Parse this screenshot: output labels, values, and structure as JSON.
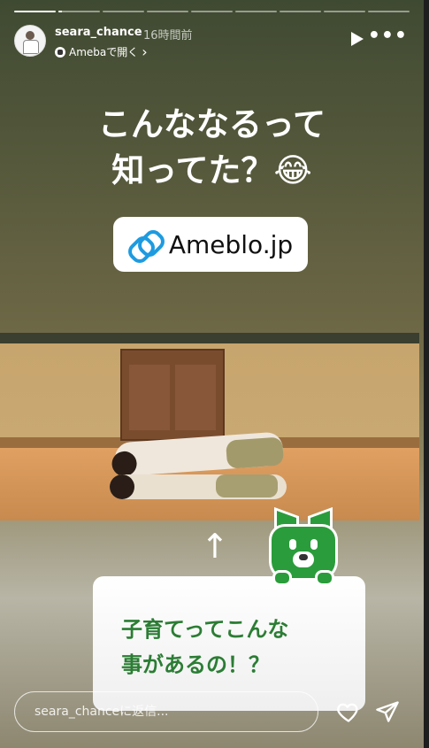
{
  "progress": {
    "segments": 9,
    "current_index": 0,
    "current_fill": 1.0,
    "second_fill": 0.08
  },
  "header": {
    "username": "seara_chance",
    "time_ago": "16時間前",
    "open_in": "Amebaで開く",
    "chevron": "›"
  },
  "story": {
    "headline_line1": "こんななるって",
    "headline_line2": "知ってた？😂",
    "link_text": "Ameblo.jp",
    "arrow": "↑",
    "quote": "子育てってこんな\n事があるの！？"
  },
  "footer": {
    "reply_placeholder": "seara_chanceに返信..."
  },
  "icons": [
    "play-icon",
    "more-icon",
    "link-icon",
    "ameba-mascot-icon",
    "heart-icon",
    "send-icon"
  ],
  "colors": {
    "accent_green": "#2b9c3b",
    "link_blue": "#1e9be0",
    "text_green": "#2b7d34"
  }
}
